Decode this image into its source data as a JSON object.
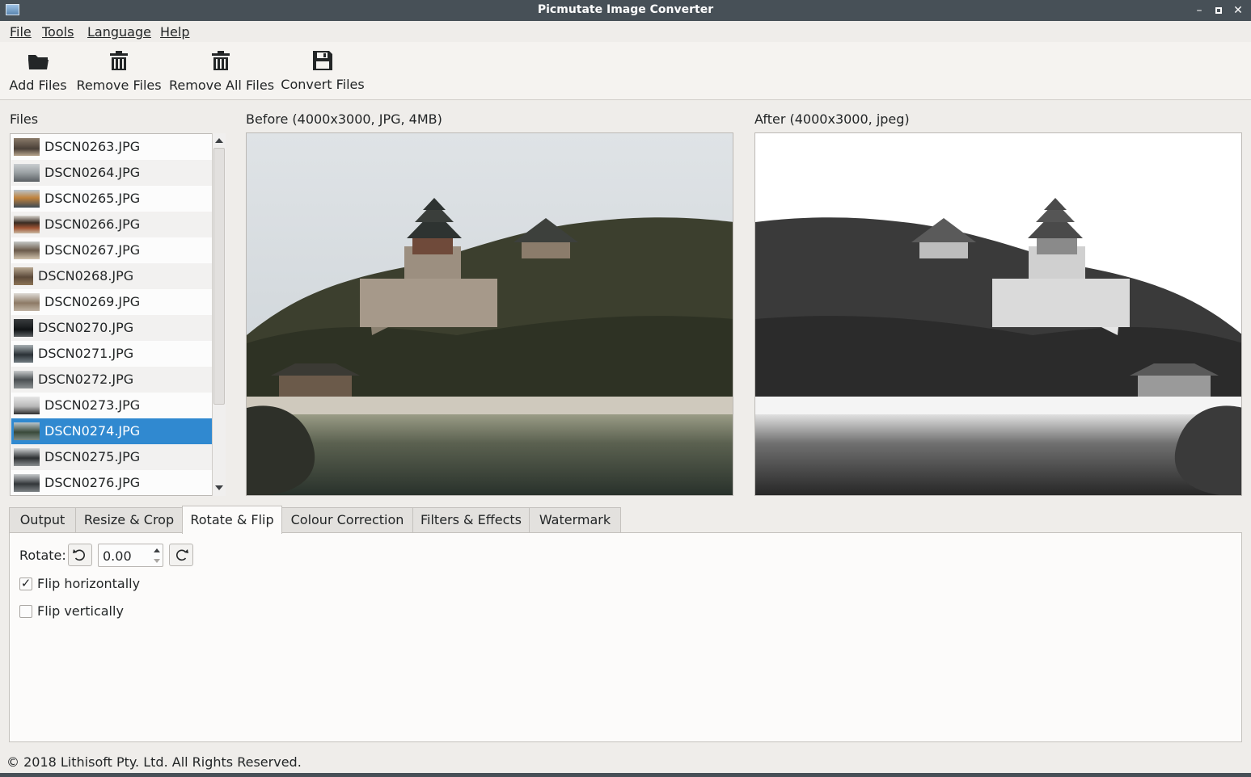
{
  "window": {
    "title": "Picmutate Image Converter"
  },
  "menu": [
    "File",
    "Tools",
    "Language",
    "Help"
  ],
  "toolbar": {
    "add_files": "Add Files",
    "remove_files": "Remove Files",
    "remove_all_files": "Remove All Files",
    "convert_files": "Convert Files"
  },
  "files": {
    "heading": "Files",
    "items": [
      "DSCN0263.JPG",
      "DSCN0264.JPG",
      "DSCN0265.JPG",
      "DSCN0266.JPG",
      "DSCN0267.JPG",
      "DSCN0268.JPG",
      "DSCN0269.JPG",
      "DSCN0270.JPG",
      "DSCN0271.JPG",
      "DSCN0272.JPG",
      "DSCN0273.JPG",
      "DSCN0274.JPG",
      "DSCN0275.JPG",
      "DSCN0276.JPG"
    ],
    "selected": "DSCN0274.JPG"
  },
  "preview": {
    "before_label": "Before (4000x3000, JPG, 4MB)",
    "after_label": "After (4000x3000, jpeg)"
  },
  "tabs": [
    "Output",
    "Resize & Crop",
    "Rotate & Flip",
    "Colour Correction",
    "Filters & Effects",
    "Watermark"
  ],
  "active_tab": "Rotate & Flip",
  "rotate_flip": {
    "rotate_label": "Rotate:",
    "rotate_value": "0.00",
    "flip_horizontally_label": "Flip horizontally",
    "flip_horizontally_checked": true,
    "flip_vertically_label": "Flip vertically",
    "flip_vertically_checked": false
  },
  "footer": "© 2018 Lithisoft Pty. Ltd. All Rights Reserved.",
  "colors": {
    "selection": "#3089d0",
    "titlebar": "#475057",
    "window_bg": "#efedea"
  }
}
